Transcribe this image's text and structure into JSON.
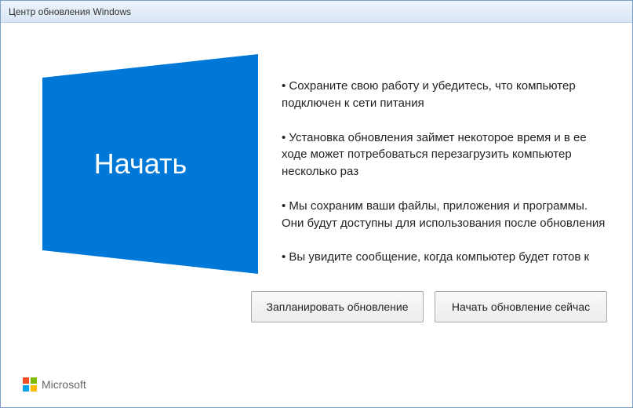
{
  "window": {
    "title": "Центр обновления Windows"
  },
  "hero": {
    "heading": "Начать"
  },
  "bullets": {
    "b1": "Сохраните свою работу и убедитесь, что компьютер подключен к сети питания",
    "b2": "Установка обновления займет некоторое время и в ее ходе может потребоваться перезагрузить компьютер несколько раз",
    "b3": "Мы сохраним ваши файлы, приложения  и программы. Они будут доступны для использования после обновления",
    "b4": "Вы увидите сообщение, когда компьютер будет готов к"
  },
  "buttons": {
    "schedule": "Запланировать обновление",
    "start_now": "Начать обновление сейчас"
  },
  "footer": {
    "brand": "Microsoft"
  },
  "colors": {
    "hero_bg": "#0078d7"
  }
}
